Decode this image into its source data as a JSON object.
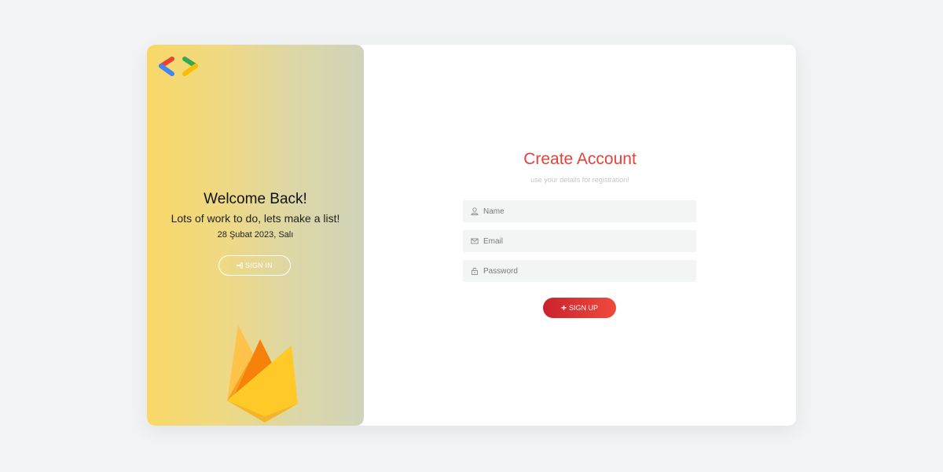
{
  "left_panel": {
    "welcome_title": "Welcome Back!",
    "welcome_subtitle": "Lots of work to do, lets make a list!",
    "date": "28 Şubat 2023, Salı",
    "signin_label": "SIGN IN",
    "gradient_colors": [
      "#f8d867",
      "#cfd3b9"
    ]
  },
  "right_panel": {
    "title": "Create Account",
    "subtitle": "use your details for registration!",
    "fields": {
      "name": {
        "placeholder": "Name",
        "value": "",
        "icon": "user-icon"
      },
      "email": {
        "placeholder": "Email",
        "value": "",
        "icon": "envelope-icon"
      },
      "password": {
        "placeholder": "Password",
        "value": "",
        "icon": "lock-icon"
      }
    },
    "signup_label": "SIGN UP",
    "accent_color": "#e8413a"
  },
  "icons": {
    "logo": "code-brackets-logo",
    "signin": "sign-in-icon",
    "signup": "plus-icon",
    "illustration": "firebase-flame-logo"
  }
}
